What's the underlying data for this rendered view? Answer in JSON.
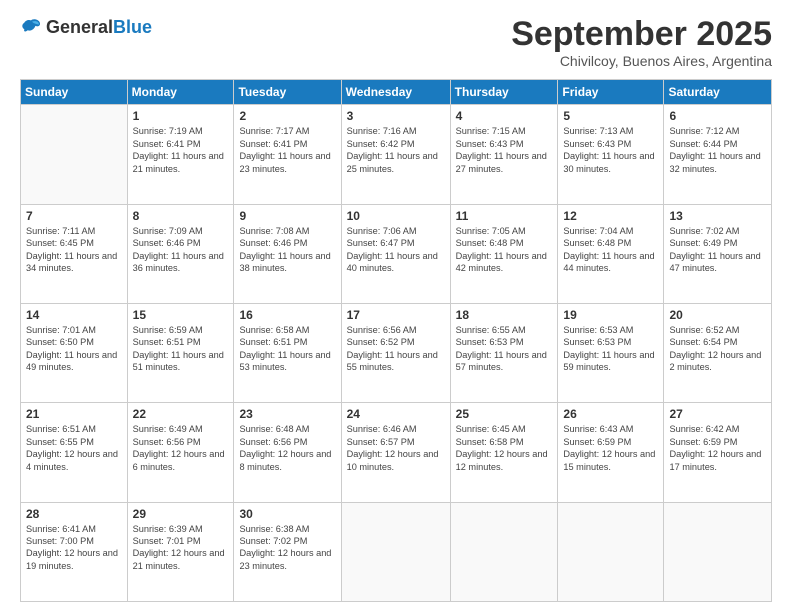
{
  "logo": {
    "general": "General",
    "blue": "Blue"
  },
  "header": {
    "month": "September 2025",
    "location": "Chivilcoy, Buenos Aires, Argentina"
  },
  "weekdays": [
    "Sunday",
    "Monday",
    "Tuesday",
    "Wednesday",
    "Thursday",
    "Friday",
    "Saturday"
  ],
  "weeks": [
    [
      {
        "day": "",
        "sunrise": "",
        "sunset": "",
        "daylight": ""
      },
      {
        "day": "1",
        "sunrise": "Sunrise: 7:19 AM",
        "sunset": "Sunset: 6:41 PM",
        "daylight": "Daylight: 11 hours and 21 minutes."
      },
      {
        "day": "2",
        "sunrise": "Sunrise: 7:17 AM",
        "sunset": "Sunset: 6:41 PM",
        "daylight": "Daylight: 11 hours and 23 minutes."
      },
      {
        "day": "3",
        "sunrise": "Sunrise: 7:16 AM",
        "sunset": "Sunset: 6:42 PM",
        "daylight": "Daylight: 11 hours and 25 minutes."
      },
      {
        "day": "4",
        "sunrise": "Sunrise: 7:15 AM",
        "sunset": "Sunset: 6:43 PM",
        "daylight": "Daylight: 11 hours and 27 minutes."
      },
      {
        "day": "5",
        "sunrise": "Sunrise: 7:13 AM",
        "sunset": "Sunset: 6:43 PM",
        "daylight": "Daylight: 11 hours and 30 minutes."
      },
      {
        "day": "6",
        "sunrise": "Sunrise: 7:12 AM",
        "sunset": "Sunset: 6:44 PM",
        "daylight": "Daylight: 11 hours and 32 minutes."
      }
    ],
    [
      {
        "day": "7",
        "sunrise": "Sunrise: 7:11 AM",
        "sunset": "Sunset: 6:45 PM",
        "daylight": "Daylight: 11 hours and 34 minutes."
      },
      {
        "day": "8",
        "sunrise": "Sunrise: 7:09 AM",
        "sunset": "Sunset: 6:46 PM",
        "daylight": "Daylight: 11 hours and 36 minutes."
      },
      {
        "day": "9",
        "sunrise": "Sunrise: 7:08 AM",
        "sunset": "Sunset: 6:46 PM",
        "daylight": "Daylight: 11 hours and 38 minutes."
      },
      {
        "day": "10",
        "sunrise": "Sunrise: 7:06 AM",
        "sunset": "Sunset: 6:47 PM",
        "daylight": "Daylight: 11 hours and 40 minutes."
      },
      {
        "day": "11",
        "sunrise": "Sunrise: 7:05 AM",
        "sunset": "Sunset: 6:48 PM",
        "daylight": "Daylight: 11 hours and 42 minutes."
      },
      {
        "day": "12",
        "sunrise": "Sunrise: 7:04 AM",
        "sunset": "Sunset: 6:48 PM",
        "daylight": "Daylight: 11 hours and 44 minutes."
      },
      {
        "day": "13",
        "sunrise": "Sunrise: 7:02 AM",
        "sunset": "Sunset: 6:49 PM",
        "daylight": "Daylight: 11 hours and 47 minutes."
      }
    ],
    [
      {
        "day": "14",
        "sunrise": "Sunrise: 7:01 AM",
        "sunset": "Sunset: 6:50 PM",
        "daylight": "Daylight: 11 hours and 49 minutes."
      },
      {
        "day": "15",
        "sunrise": "Sunrise: 6:59 AM",
        "sunset": "Sunset: 6:51 PM",
        "daylight": "Daylight: 11 hours and 51 minutes."
      },
      {
        "day": "16",
        "sunrise": "Sunrise: 6:58 AM",
        "sunset": "Sunset: 6:51 PM",
        "daylight": "Daylight: 11 hours and 53 minutes."
      },
      {
        "day": "17",
        "sunrise": "Sunrise: 6:56 AM",
        "sunset": "Sunset: 6:52 PM",
        "daylight": "Daylight: 11 hours and 55 minutes."
      },
      {
        "day": "18",
        "sunrise": "Sunrise: 6:55 AM",
        "sunset": "Sunset: 6:53 PM",
        "daylight": "Daylight: 11 hours and 57 minutes."
      },
      {
        "day": "19",
        "sunrise": "Sunrise: 6:53 AM",
        "sunset": "Sunset: 6:53 PM",
        "daylight": "Daylight: 11 hours and 59 minutes."
      },
      {
        "day": "20",
        "sunrise": "Sunrise: 6:52 AM",
        "sunset": "Sunset: 6:54 PM",
        "daylight": "Daylight: 12 hours and 2 minutes."
      }
    ],
    [
      {
        "day": "21",
        "sunrise": "Sunrise: 6:51 AM",
        "sunset": "Sunset: 6:55 PM",
        "daylight": "Daylight: 12 hours and 4 minutes."
      },
      {
        "day": "22",
        "sunrise": "Sunrise: 6:49 AM",
        "sunset": "Sunset: 6:56 PM",
        "daylight": "Daylight: 12 hours and 6 minutes."
      },
      {
        "day": "23",
        "sunrise": "Sunrise: 6:48 AM",
        "sunset": "Sunset: 6:56 PM",
        "daylight": "Daylight: 12 hours and 8 minutes."
      },
      {
        "day": "24",
        "sunrise": "Sunrise: 6:46 AM",
        "sunset": "Sunset: 6:57 PM",
        "daylight": "Daylight: 12 hours and 10 minutes."
      },
      {
        "day": "25",
        "sunrise": "Sunrise: 6:45 AM",
        "sunset": "Sunset: 6:58 PM",
        "daylight": "Daylight: 12 hours and 12 minutes."
      },
      {
        "day": "26",
        "sunrise": "Sunrise: 6:43 AM",
        "sunset": "Sunset: 6:59 PM",
        "daylight": "Daylight: 12 hours and 15 minutes."
      },
      {
        "day": "27",
        "sunrise": "Sunrise: 6:42 AM",
        "sunset": "Sunset: 6:59 PM",
        "daylight": "Daylight: 12 hours and 17 minutes."
      }
    ],
    [
      {
        "day": "28",
        "sunrise": "Sunrise: 6:41 AM",
        "sunset": "Sunset: 7:00 PM",
        "daylight": "Daylight: 12 hours and 19 minutes."
      },
      {
        "day": "29",
        "sunrise": "Sunrise: 6:39 AM",
        "sunset": "Sunset: 7:01 PM",
        "daylight": "Daylight: 12 hours and 21 minutes."
      },
      {
        "day": "30",
        "sunrise": "Sunrise: 6:38 AM",
        "sunset": "Sunset: 7:02 PM",
        "daylight": "Daylight: 12 hours and 23 minutes."
      },
      {
        "day": "",
        "sunrise": "",
        "sunset": "",
        "daylight": ""
      },
      {
        "day": "",
        "sunrise": "",
        "sunset": "",
        "daylight": ""
      },
      {
        "day": "",
        "sunrise": "",
        "sunset": "",
        "daylight": ""
      },
      {
        "day": "",
        "sunrise": "",
        "sunset": "",
        "daylight": ""
      }
    ]
  ]
}
